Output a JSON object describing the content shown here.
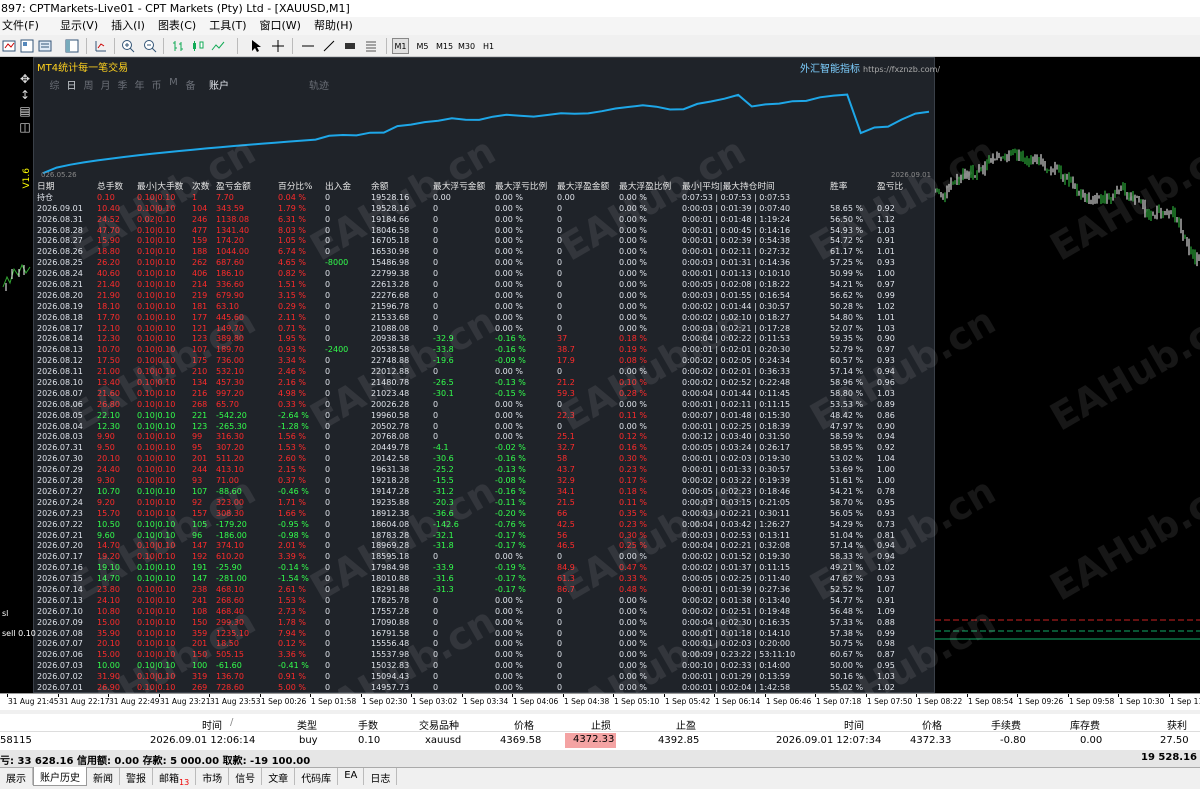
{
  "window": {
    "title": "897: CPTMarkets-Live01 - CPT Markets (Pty) Ltd - [XAUUSD,M1]"
  },
  "menu": [
    "文件(F)",
    "显示(V)",
    "插入(I)",
    "图表(C)",
    "工具(T)",
    "窗口(W)",
    "帮助(H)"
  ],
  "toolbar": {
    "timeframes": [
      "M1",
      "M5",
      "M15",
      "M30",
      "H1"
    ],
    "active_timeframe": "M1"
  },
  "panel": {
    "title": "MT4统计每一笔交易",
    "link_label": "外汇智能指标",
    "link_url": "https://fxznzb.com/",
    "tabs": [
      "综",
      "日",
      "周",
      "月",
      "季",
      "年",
      "币",
      "M",
      "备",
      "账户",
      "轨迹"
    ],
    "active_tab": "日",
    "equity_start": "026.05.26",
    "equity_end": "2026.09.01",
    "side_label": "V1.6",
    "watermark": "EAHub.cn",
    "headers": [
      "日期",
      "总手数",
      "最小|大手数",
      "次数",
      "盈亏金额",
      "百分比%",
      "出入金",
      "余额",
      "最大浮亏金额",
      "最大浮亏比例",
      "最大浮盈金额",
      "最大浮盈比例",
      "最小|平均|最大持仓时间",
      "胜率",
      "盈亏比"
    ],
    "holding_label": "持仓",
    "holding_row": {
      "tot": "0.10",
      "rng": "0.10|0.10",
      "cnt": "1",
      "pl": "7.70",
      "pct": "0.04 %",
      "io": "0",
      "bal": "19528.16",
      "fl": "0.00",
      "flp": "0.00 %",
      "fp": "0.00",
      "fpp": "0.00 %",
      "time": "0:07:53 | 0:07:53 | 0:07:53",
      "win": "",
      "ratio": ""
    },
    "rows": [
      [
        "2026.09.01",
        "10.40",
        "0.10|0.10",
        "104",
        "343.59",
        "1.79 %",
        "0",
        "19528.16",
        "0",
        "0.00 %",
        "0",
        "0.00 %",
        "0:00:03 | 0:01:39 | 0:07:40",
        "58.65 %",
        "0.92",
        "r"
      ],
      [
        "2026.08.31",
        "24.52",
        "0.02|0.10",
        "246",
        "1138.08",
        "6.31 %",
        "0",
        "19184.66",
        "0",
        "0.00 %",
        "0",
        "0.00 %",
        "0:00:01 | 0:01:48 | 1:19:24",
        "56.50 %",
        "1.12",
        "r"
      ],
      [
        "2026.08.28",
        "47.70",
        "0.10|0.10",
        "477",
        "1341.40",
        "8.03 %",
        "0",
        "18046.58",
        "0",
        "0.00 %",
        "0",
        "0.00 %",
        "0:00:01 | 0:00:45 | 0:14:16",
        "54.93 %",
        "1.03",
        "r"
      ],
      [
        "2026.08.27",
        "15.90",
        "0.10|0.10",
        "159",
        "174.20",
        "1.05 %",
        "0",
        "16705.18",
        "0",
        "0.00 %",
        "0",
        "0.00 %",
        "0:00:01 | 0:02:39 | 0:54:38",
        "54.72 %",
        "0.91",
        "r"
      ],
      [
        "2026.08.26",
        "18.80",
        "0.10|0.10",
        "188",
        "1044.00",
        "6.74 %",
        "0",
        "16530.98",
        "0",
        "0.00 %",
        "0",
        "0.00 %",
        "0:00:01 | 0:02:11 | 0:27:32",
        "61.17 %",
        "1.01",
        "r"
      ],
      [
        "2026.08.25",
        "26.20",
        "0.10|0.10",
        "262",
        "687.60",
        "4.65 %",
        "-8000",
        "15486.98",
        "0",
        "0.00 %",
        "0",
        "0.00 %",
        "0:00:03 | 0:01:31 | 0:14:36",
        "57.25 %",
        "0.93",
        "r"
      ],
      [
        "2026.08.24",
        "40.60",
        "0.10|0.10",
        "406",
        "186.10",
        "0.82 %",
        "0",
        "22799.38",
        "0",
        "0.00 %",
        "0",
        "0.00 %",
        "0:00:01 | 0:01:13 | 0:10:10",
        "50.99 %",
        "1.00",
        "r"
      ],
      [
        "2026.08.21",
        "21.40",
        "0.10|0.10",
        "214",
        "336.60",
        "1.51 %",
        "0",
        "22613.28",
        "0",
        "0.00 %",
        "0",
        "0.00 %",
        "0:00:05 | 0:02:08 | 0:18:22",
        "54.21 %",
        "0.97",
        "r"
      ],
      [
        "2026.08.20",
        "21.90",
        "0.10|0.10",
        "219",
        "679.90",
        "3.15 %",
        "0",
        "22276.68",
        "0",
        "0.00 %",
        "0",
        "0.00 %",
        "0:00:03 | 0:01:55 | 0:16:54",
        "56.62 %",
        "0.99",
        "r"
      ],
      [
        "2026.08.19",
        "18.10",
        "0.10|0.10",
        "181",
        "63.10",
        "0.29 %",
        "0",
        "21596.78",
        "0",
        "0.00 %",
        "0",
        "0.00 %",
        "0:00:02 | 0:01:44 | 0:30:57",
        "50.28 %",
        "1.02",
        "r"
      ],
      [
        "2026.08.18",
        "17.70",
        "0.10|0.10",
        "177",
        "445.60",
        "2.11 %",
        "0",
        "21533.68",
        "0",
        "0.00 %",
        "0",
        "0.00 %",
        "0:00:02 | 0:02:10 | 0:18:27",
        "54.80 %",
        "1.01",
        "r"
      ],
      [
        "2026.08.17",
        "12.10",
        "0.10|0.10",
        "121",
        "149.70",
        "0.71 %",
        "0",
        "21088.08",
        "0",
        "0.00 %",
        "0",
        "0.00 %",
        "0:00:03 | 0:02:21 | 0:17:28",
        "52.07 %",
        "1.03",
        "r"
      ],
      [
        "2026.08.14",
        "12.30",
        "0.10|0.10",
        "123",
        "389.80",
        "1.95 %",
        "0",
        "20938.38",
        "-32.9",
        "-0.16 %",
        "37",
        "0.18 %",
        "0:00:04 | 0:02:22 | 0:11:53",
        "59.35 %",
        "0.90",
        "r"
      ],
      [
        "2026.08.13",
        "10.70",
        "0.10|0.10",
        "107",
        "189.70",
        "0.93 %",
        "-2400",
        "20538.58",
        "-33.8",
        "-0.16 %",
        "38.7",
        "0.19 %",
        "0:00:01 | 0:02:01 | 0:20:30",
        "52.79 %",
        "0.97",
        "r"
      ],
      [
        "2026.08.12",
        "17.50",
        "0.10|0.10",
        "175",
        "736.00",
        "3.34 %",
        "0",
        "22748.88",
        "-19.6",
        "-0.09 %",
        "17.9",
        "0.08 %",
        "0:00:02 | 0:02:05 | 0:24:34",
        "60.57 %",
        "0.93",
        "r"
      ],
      [
        "2026.08.11",
        "21.00",
        "0.10|0.10",
        "210",
        "532.10",
        "2.46 %",
        "0",
        "22012.88",
        "0",
        "0.00 %",
        "0",
        "0.00 %",
        "0:00:02 | 0:02:01 | 0:36:33",
        "57.14 %",
        "0.94",
        "r"
      ],
      [
        "2026.08.10",
        "13.40",
        "0.10|0.10",
        "134",
        "457.30",
        "2.16 %",
        "0",
        "21480.78",
        "-26.5",
        "-0.13 %",
        "21.2",
        "0.10 %",
        "0:00:02 | 0:02:52 | 0:22:48",
        "58.96 %",
        "0.96",
        "r"
      ],
      [
        "2026.08.07",
        "21.60",
        "0.10|0.10",
        "216",
        "997.20",
        "4.98 %",
        "0",
        "21023.48",
        "-30.1",
        "-0.15 %",
        "59.3",
        "0.28 %",
        "0:00:04 | 0:01:44 | 0:11:45",
        "58.80 %",
        "1.03",
        "r"
      ],
      [
        "2026.08.06",
        "26.80",
        "0.10|0.10",
        "268",
        "65.70",
        "0.33 %",
        "0",
        "20026.28",
        "0",
        "0.00 %",
        "0",
        "0.00 %",
        "0:00:01 | 0:02:11 | 0:11:15",
        "53.53 %",
        "0.89",
        "r"
      ],
      [
        "2026.08.05",
        "22.10",
        "0.10|0.10",
        "221",
        "-542.20",
        "-2.64 %",
        "0",
        "19960.58",
        "0",
        "0.00 %",
        "22.3",
        "0.11 %",
        "0:00:07 | 0:01:48 | 0:15:30",
        "48.42 %",
        "0.86",
        "g"
      ],
      [
        "2026.08.04",
        "12.30",
        "0.10|0.10",
        "123",
        "-265.30",
        "-1.28 %",
        "0",
        "20502.78",
        "0",
        "0.00 %",
        "0",
        "0.00 %",
        "0:00:01 | 0:02:25 | 0:18:39",
        "47.97 %",
        "0.90",
        "g"
      ],
      [
        "2026.08.03",
        "9.90",
        "0.10|0.10",
        "99",
        "316.30",
        "1.56 %",
        "0",
        "20768.08",
        "0",
        "0.00 %",
        "25.1",
        "0.12 %",
        "0:00:12 | 0:03:40 | 0:31:50",
        "58.59 %",
        "0.94",
        "r"
      ],
      [
        "2026.07.31",
        "9.50",
        "0.10|0.10",
        "95",
        "307.20",
        "1.53 %",
        "0",
        "20449.78",
        "-4.1",
        "-0.02 %",
        "32.7",
        "0.16 %",
        "0:00:05 | 0:03:24 | 0:26:17",
        "58.95 %",
        "0.92",
        "r"
      ],
      [
        "2026.07.30",
        "20.10",
        "0.10|0.10",
        "201",
        "511.20",
        "2.60 %",
        "0",
        "20142.58",
        "-30.6",
        "-0.16 %",
        "58",
        "0.30 %",
        "0:00:01 | 0:02:03 | 0:19:30",
        "53.02 %",
        "1.04",
        "r"
      ],
      [
        "2026.07.29",
        "24.40",
        "0.10|0.10",
        "244",
        "413.10",
        "2.15 %",
        "0",
        "19631.38",
        "-25.2",
        "-0.13 %",
        "43.7",
        "0.23 %",
        "0:00:01 | 0:01:33 | 0:30:57",
        "53.69 %",
        "1.00",
        "r"
      ],
      [
        "2026.07.28",
        "9.30",
        "0.10|0.10",
        "93",
        "71.00",
        "0.37 %",
        "0",
        "19218.28",
        "-15.5",
        "-0.08 %",
        "32.9",
        "0.17 %",
        "0:00:02 | 0:03:22 | 0:19:39",
        "51.61 %",
        "1.00",
        "r"
      ],
      [
        "2026.07.27",
        "10.70",
        "0.10|0.10",
        "107",
        "-88.60",
        "-0.46 %",
        "0",
        "19147.28",
        "-31.2",
        "-0.16 %",
        "34.1",
        "0.18 %",
        "0:00:05 | 0:02:23 | 0:18:46",
        "54.21 %",
        "0.78",
        "g"
      ],
      [
        "2026.07.24",
        "9.20",
        "0.10|0.10",
        "92",
        "323.00",
        "1.71 %",
        "0",
        "19235.88",
        "-20.3",
        "-0.11 %",
        "21.5",
        "0.11 %",
        "0:00:03 | 0:03:15 | 0:21:05",
        "58.70 %",
        "0.95",
        "r"
      ],
      [
        "2026.07.23",
        "15.70",
        "0.10|0.10",
        "157",
        "308.30",
        "1.66 %",
        "0",
        "18912.38",
        "-36.6",
        "-0.20 %",
        "66",
        "0.35 %",
        "0:00:03 | 0:02:21 | 0:30:11",
        "56.05 %",
        "0.93",
        "r"
      ],
      [
        "2026.07.22",
        "10.50",
        "0.10|0.10",
        "105",
        "-179.20",
        "-0.95 %",
        "0",
        "18604.08",
        "-142.6",
        "-0.76 %",
        "42.5",
        "0.23 %",
        "0:00:04 | 0:03:42 | 1:26:27",
        "54.29 %",
        "0.73",
        "g"
      ],
      [
        "2026.07.21",
        "9.60",
        "0.10|0.10",
        "96",
        "-186.00",
        "-0.98 %",
        "0",
        "18783.28",
        "-32.1",
        "-0.17 %",
        "56",
        "0.30 %",
        "0:00:03 | 0:02:53 | 0:13:11",
        "51.04 %",
        "0.81",
        "g"
      ],
      [
        "2026.07.20",
        "14.70",
        "0.10|0.10",
        "147",
        "374.10",
        "2.01 %",
        "0",
        "18969.28",
        "-31.8",
        "-0.17 %",
        "46.5",
        "0.25 %",
        "0:00:04 | 0:02:21 | 0:32:08",
        "57.14 %",
        "0.94",
        "r"
      ],
      [
        "2026.07.17",
        "19.20",
        "0.10|0.10",
        "192",
        "610.20",
        "3.39 %",
        "0",
        "18595.18",
        "0",
        "0.00 %",
        "0",
        "0.00 %",
        "0:00:02 | 0:01:52 | 0:19:30",
        "58.33 %",
        "0.94",
        "r"
      ],
      [
        "2026.07.16",
        "19.10",
        "0.10|0.10",
        "191",
        "-25.90",
        "-0.14 %",
        "0",
        "17984.98",
        "-33.9",
        "-0.19 %",
        "84.9",
        "0.47 %",
        "0:00:02 | 0:01:37 | 0:11:15",
        "49.21 %",
        "1.02",
        "g"
      ],
      [
        "2026.07.15",
        "14.70",
        "0.10|0.10",
        "147",
        "-281.00",
        "-1.54 %",
        "0",
        "18010.88",
        "-31.6",
        "-0.17 %",
        "61.3",
        "0.33 %",
        "0:00:05 | 0:02:25 | 0:11:40",
        "47.62 %",
        "0.93",
        "g"
      ],
      [
        "2026.07.14",
        "23.80",
        "0.10|0.10",
        "238",
        "468.10",
        "2.61 %",
        "0",
        "18291.88",
        "-31.3",
        "-0.17 %",
        "86.7",
        "0.48 %",
        "0:00:01 | 0:01:39 | 0:27:36",
        "52.52 %",
        "1.07",
        "r"
      ],
      [
        "2026.07.13",
        "24.10",
        "0.10|0.10",
        "241",
        "268.60",
        "1.53 %",
        "0",
        "17825.78",
        "0",
        "0.00 %",
        "0",
        "0.00 %",
        "0:00:02 | 0:01:38 | 0:13:40",
        "54.77 %",
        "0.91",
        "r"
      ],
      [
        "2026.07.10",
        "10.80",
        "0.10|0.10",
        "108",
        "468.40",
        "2.73 %",
        "0",
        "17557.28",
        "0",
        "0.00 %",
        "0",
        "0.00 %",
        "0:00:02 | 0:02:51 | 0:19:48",
        "56.48 %",
        "1.09",
        "r"
      ],
      [
        "2026.07.09",
        "15.00",
        "0.10|0.10",
        "150",
        "299.30",
        "1.78 %",
        "0",
        "17090.88",
        "0",
        "0.00 %",
        "0",
        "0.00 %",
        "0:00:04 | 0:02:30 | 0:16:35",
        "57.33 %",
        "0.88",
        "r"
      ],
      [
        "2026.07.08",
        "35.90",
        "0.10|0.10",
        "359",
        "1235.10",
        "7.94 %",
        "0",
        "16791.58",
        "0",
        "0.00 %",
        "0",
        "0.00 %",
        "0:00:01 | 0:01:18 | 0:14:10",
        "57.38 %",
        "0.99",
        "r"
      ],
      [
        "2026.07.07",
        "20.10",
        "0.10|0.10",
        "201",
        "18.50",
        "0.12 %",
        "0",
        "15556.48",
        "0",
        "0.00 %",
        "0",
        "0.00 %",
        "0:00:01 | 0:02:03 | 0:20:00",
        "50.75 %",
        "0.98",
        "r"
      ],
      [
        "2026.07.06",
        "15.00",
        "0.10|0.10",
        "150",
        "505.15",
        "3.36 %",
        "0",
        "15537.98",
        "0",
        "0.00 %",
        "0",
        "0.00 %",
        "0:00:09 | 0:23:22 | 53:11:10",
        "60.67 %",
        "0.87",
        "r"
      ],
      [
        "2026.07.03",
        "10.00",
        "0.10|0.10",
        "100",
        "-61.60",
        "-0.41 %",
        "0",
        "15032.83",
        "0",
        "0.00 %",
        "0",
        "0.00 %",
        "0:00:10 | 0:02:33 | 0:14:00",
        "50.00 %",
        "0.95",
        "g"
      ],
      [
        "2026.07.02",
        "31.90",
        "0.10|0.10",
        "319",
        "136.70",
        "0.91 %",
        "0",
        "15094.43",
        "0",
        "0.00 %",
        "0",
        "0.00 %",
        "0:00:01 | 0:01:29 | 0:13:59",
        "50.16 %",
        "1.03",
        "r"
      ],
      [
        "2026.07.01",
        "26.90",
        "0.10|0.10",
        "269",
        "728.60",
        "5.00 %",
        "0",
        "14957.73",
        "0",
        "0.00 %",
        "0",
        "0.00 %",
        "0:00:01 | 0:02:04 | 1:42:58",
        "55.02 %",
        "1.02",
        "r"
      ]
    ]
  },
  "chart": {
    "sl_label": "sl",
    "sell_label": "sell 0.10",
    "time_labels": [
      "31 Aug 21:45",
      "31 Aug 22:17",
      "31 Aug 22:49",
      "31 Aug 23:21",
      "31 Aug 23:53",
      "1 Sep 00:26",
      "1 Sep 01:58",
      "1 Sep 02:30",
      "1 Sep 03:02",
      "1 Sep 03:34",
      "1 Sep 04:06",
      "1 Sep 04:38",
      "1 Sep 05:10",
      "1 Sep 05:42",
      "1 Sep 06:14",
      "1 Sep 06:46",
      "1 Sep 07:18",
      "1 Sep 07:50",
      "1 Sep 08:22",
      "1 Sep 08:54",
      "1 Sep 09:26",
      "1 Sep 09:58",
      "1 Sep 10:30",
      "1 Sep 11:02"
    ]
  },
  "terminal": {
    "headers": [
      "时间",
      "类型",
      "手数",
      "交易品种",
      "价格",
      "止损",
      "止盈",
      "时间",
      "价格",
      "手续费",
      "库存费",
      "获利"
    ],
    "sort_indicator": "/",
    "order": {
      "ticket": "58115",
      "open_time": "2026.09.01 12:06:14",
      "type": "buy",
      "lots": "0.10",
      "symbol": "xauusd",
      "open_price": "4369.58",
      "sl": "4372.33",
      "tp": "4392.85",
      "close_time": "2026.09.01 12:07:34",
      "close_price": "4372.33",
      "commission": "-0.80",
      "swap": "0.00",
      "profit": "27.50"
    },
    "summary": "亏: 33 628.16  信用额: 0.00  存款: 5 000.00  取款: -19 100.00",
    "summary_total": "19 528.16",
    "tabs": [
      "展示",
      "账户历史",
      "新闻",
      "警报",
      "邮箱",
      "市场",
      "信号",
      "文章",
      "代码库",
      "EA",
      "日志"
    ],
    "active_tab": "账户历史",
    "mail_count": "13"
  }
}
